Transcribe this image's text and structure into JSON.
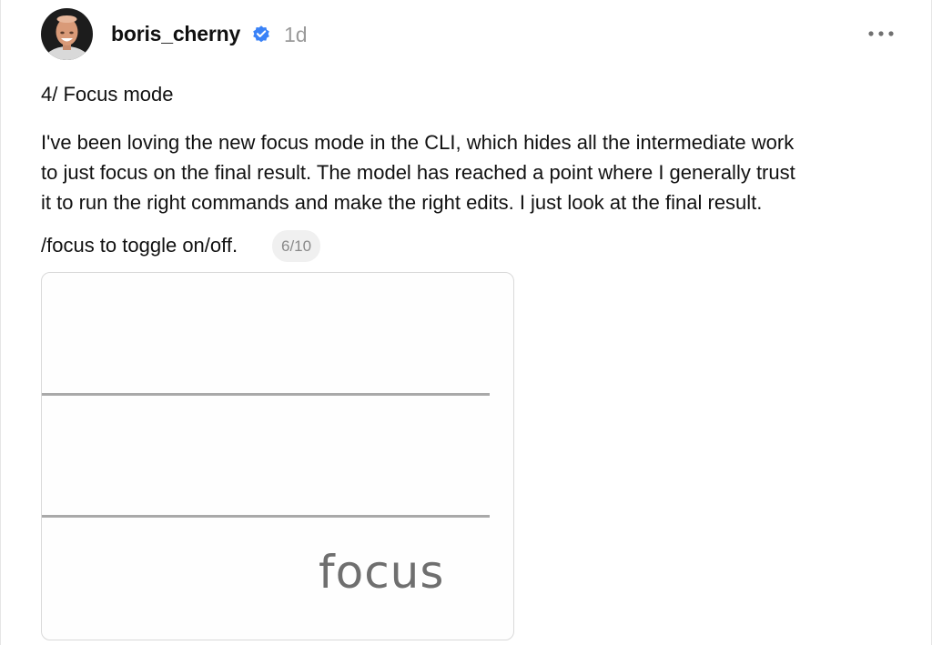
{
  "post": {
    "author": {
      "username": "boris_cherny",
      "verified": true,
      "avatar_icon": "user-avatar"
    },
    "timestamp": "1d",
    "more_icon": "ellipsis-icon",
    "heading": "4/ Focus mode",
    "body_lines": [
      "I've been loving the new focus mode in the CLI, which hides all the intermediate work",
      "to just focus on the final result. The model has reached a point where I generally trust",
      "it to run the right commands and make the right edits. I just look at the final result."
    ],
    "toggle_text": "/focus to toggle on/off.",
    "counter": "6/10",
    "media": {
      "caption_word": "focus"
    }
  },
  "colors": {
    "verified": "#3a82f7",
    "muted_text": "#9a9a9a",
    "badge_bg": "#f0f0f0",
    "rule": "#a9a9a9"
  }
}
